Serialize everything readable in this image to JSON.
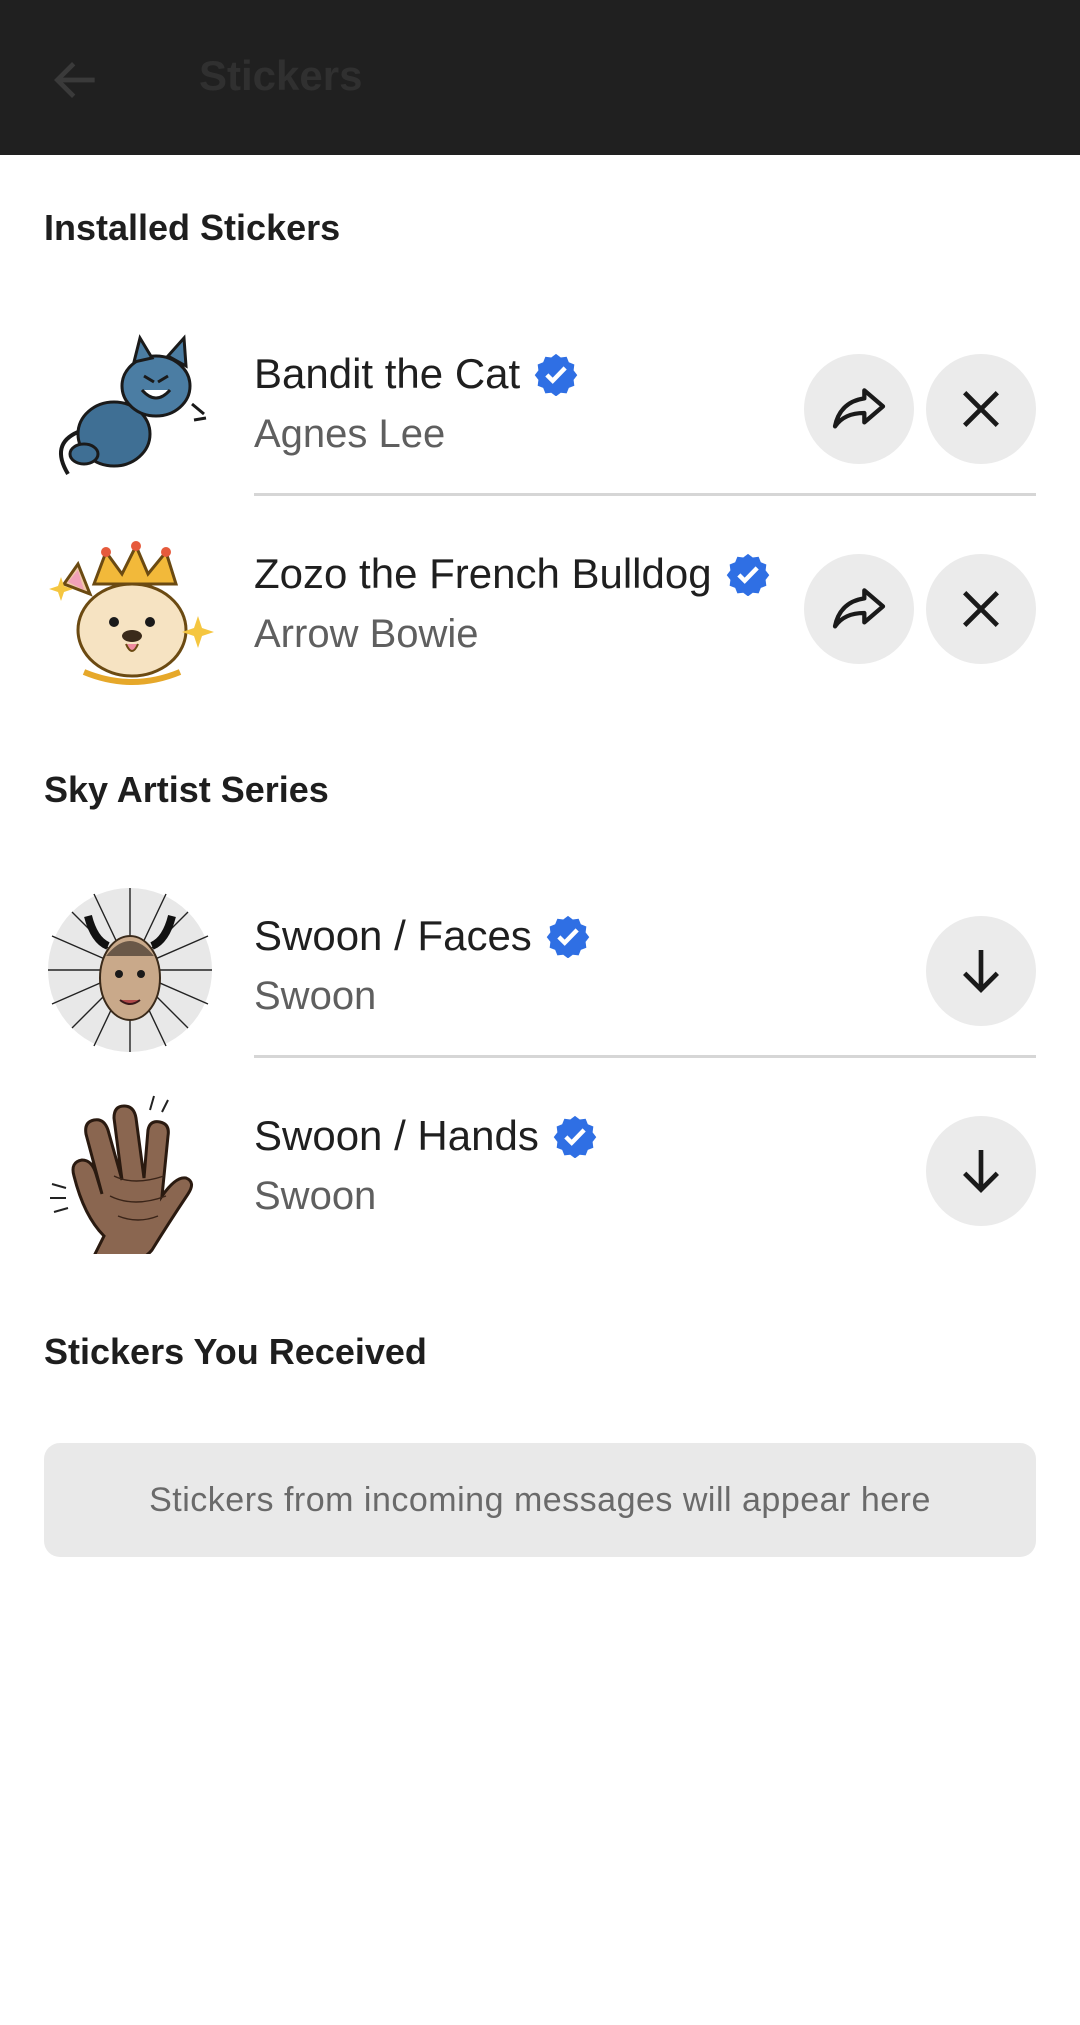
{
  "appbar": {
    "title": "Stickers",
    "back_icon": "arrow-left-icon"
  },
  "sections": {
    "installed": {
      "title": "Installed Stickers",
      "items": [
        {
          "title": "Bandit the Cat",
          "author": "Agnes Lee",
          "verified": true,
          "actions": [
            "share-icon",
            "close-icon"
          ]
        },
        {
          "title": "Zozo the French Bulldog",
          "author": "Arrow Bowie",
          "verified": true,
          "actions": [
            "share-icon",
            "close-icon"
          ]
        }
      ]
    },
    "artist": {
      "title": "Sky Artist Series",
      "items": [
        {
          "title": "Swoon / Faces",
          "author": "Swoon",
          "verified": true,
          "actions": [
            "download-icon"
          ]
        },
        {
          "title": "Swoon / Hands",
          "author": "Swoon",
          "verified": true,
          "actions": [
            "download-icon"
          ]
        }
      ]
    },
    "received": {
      "title": "Stickers You Received",
      "empty_message": "Stickers from incoming messages will appear here"
    }
  },
  "colors": {
    "appbar_bg": "#202020",
    "verified_blue": "#2f6fe4",
    "button_bg": "#ebebeb",
    "divider": "#d6d6d6"
  }
}
